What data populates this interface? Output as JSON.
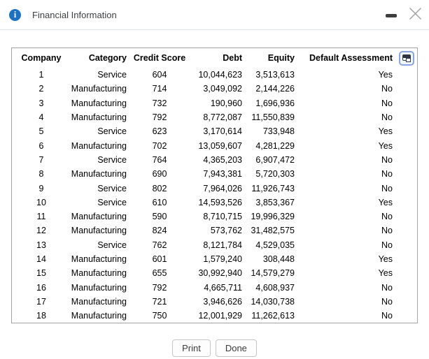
{
  "dialog": {
    "title": "Financial Information"
  },
  "table": {
    "columns": [
      "Company",
      "Category",
      "Credit Score",
      "Debt",
      "Equity",
      "Default Assessment"
    ],
    "rows": [
      [
        "1",
        "Service",
        "604",
        "10,044,623",
        "3,513,613",
        "Yes"
      ],
      [
        "2",
        "Manufacturing",
        "714",
        "3,049,092",
        "2,144,226",
        "No"
      ],
      [
        "3",
        "Manufacturing",
        "732",
        "190,960",
        "1,696,936",
        "No"
      ],
      [
        "4",
        "Manufacturing",
        "792",
        "8,772,087",
        "11,550,839",
        "No"
      ],
      [
        "5",
        "Service",
        "623",
        "3,170,614",
        "733,948",
        "Yes"
      ],
      [
        "6",
        "Manufacturing",
        "702",
        "13,059,607",
        "4,281,229",
        "Yes"
      ],
      [
        "7",
        "Service",
        "764",
        "4,365,203",
        "6,907,472",
        "No"
      ],
      [
        "8",
        "Manufacturing",
        "690",
        "7,943,381",
        "5,720,303",
        "No"
      ],
      [
        "9",
        "Service",
        "802",
        "7,964,026",
        "11,926,743",
        "No"
      ],
      [
        "10",
        "Service",
        "610",
        "14,593,526",
        "3,853,367",
        "Yes"
      ],
      [
        "11",
        "Manufacturing",
        "590",
        "8,710,715",
        "19,996,329",
        "No"
      ],
      [
        "12",
        "Manufacturing",
        "824",
        "573,762",
        "31,482,575",
        "No"
      ],
      [
        "13",
        "Service",
        "762",
        "8,121,784",
        "4,529,035",
        "No"
      ],
      [
        "14",
        "Manufacturing",
        "601",
        "1,579,240",
        "308,448",
        "Yes"
      ],
      [
        "15",
        "Manufacturing",
        "655",
        "30,992,940",
        "14,579,279",
        "Yes"
      ],
      [
        "16",
        "Manufacturing",
        "792",
        "4,665,711",
        "4,608,937",
        "No"
      ],
      [
        "17",
        "Manufacturing",
        "721",
        "3,946,626",
        "14,030,738",
        "No"
      ],
      [
        "18",
        "Manufacturing",
        "750",
        "12,001,929",
        "11,262,613",
        "No"
      ]
    ]
  },
  "icons": {
    "info": "i"
  },
  "buttons": {
    "print": "Print",
    "done": "Done"
  }
}
